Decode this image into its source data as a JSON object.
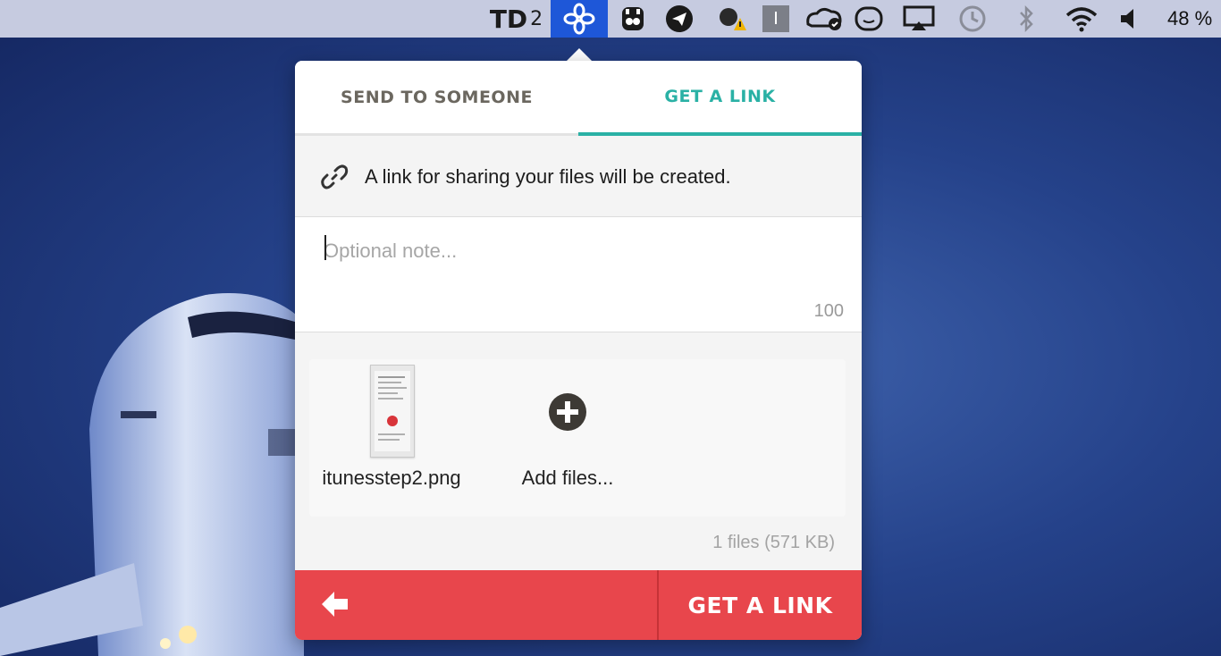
{
  "menubar": {
    "todoist_label": "TD",
    "todoist_count": "2",
    "battery_percent": "48 %"
  },
  "popover": {
    "tabs": [
      {
        "label": "SEND TO SOMEONE",
        "active": false
      },
      {
        "label": "GET A LINK",
        "active": true
      }
    ],
    "info_text": "A link for sharing your files will be created.",
    "note": {
      "placeholder": "Optional note...",
      "value": "",
      "char_limit": "100"
    },
    "files": [
      {
        "name": "itunesstep2.png"
      }
    ],
    "add_files_label": "Add files...",
    "summary": "1 files (571 KB)",
    "primary_button": "GET A LINK"
  },
  "colors": {
    "accent_teal": "#2ab1a5",
    "button_red": "#e8464c",
    "menubar_highlight": "#1e57d8"
  }
}
